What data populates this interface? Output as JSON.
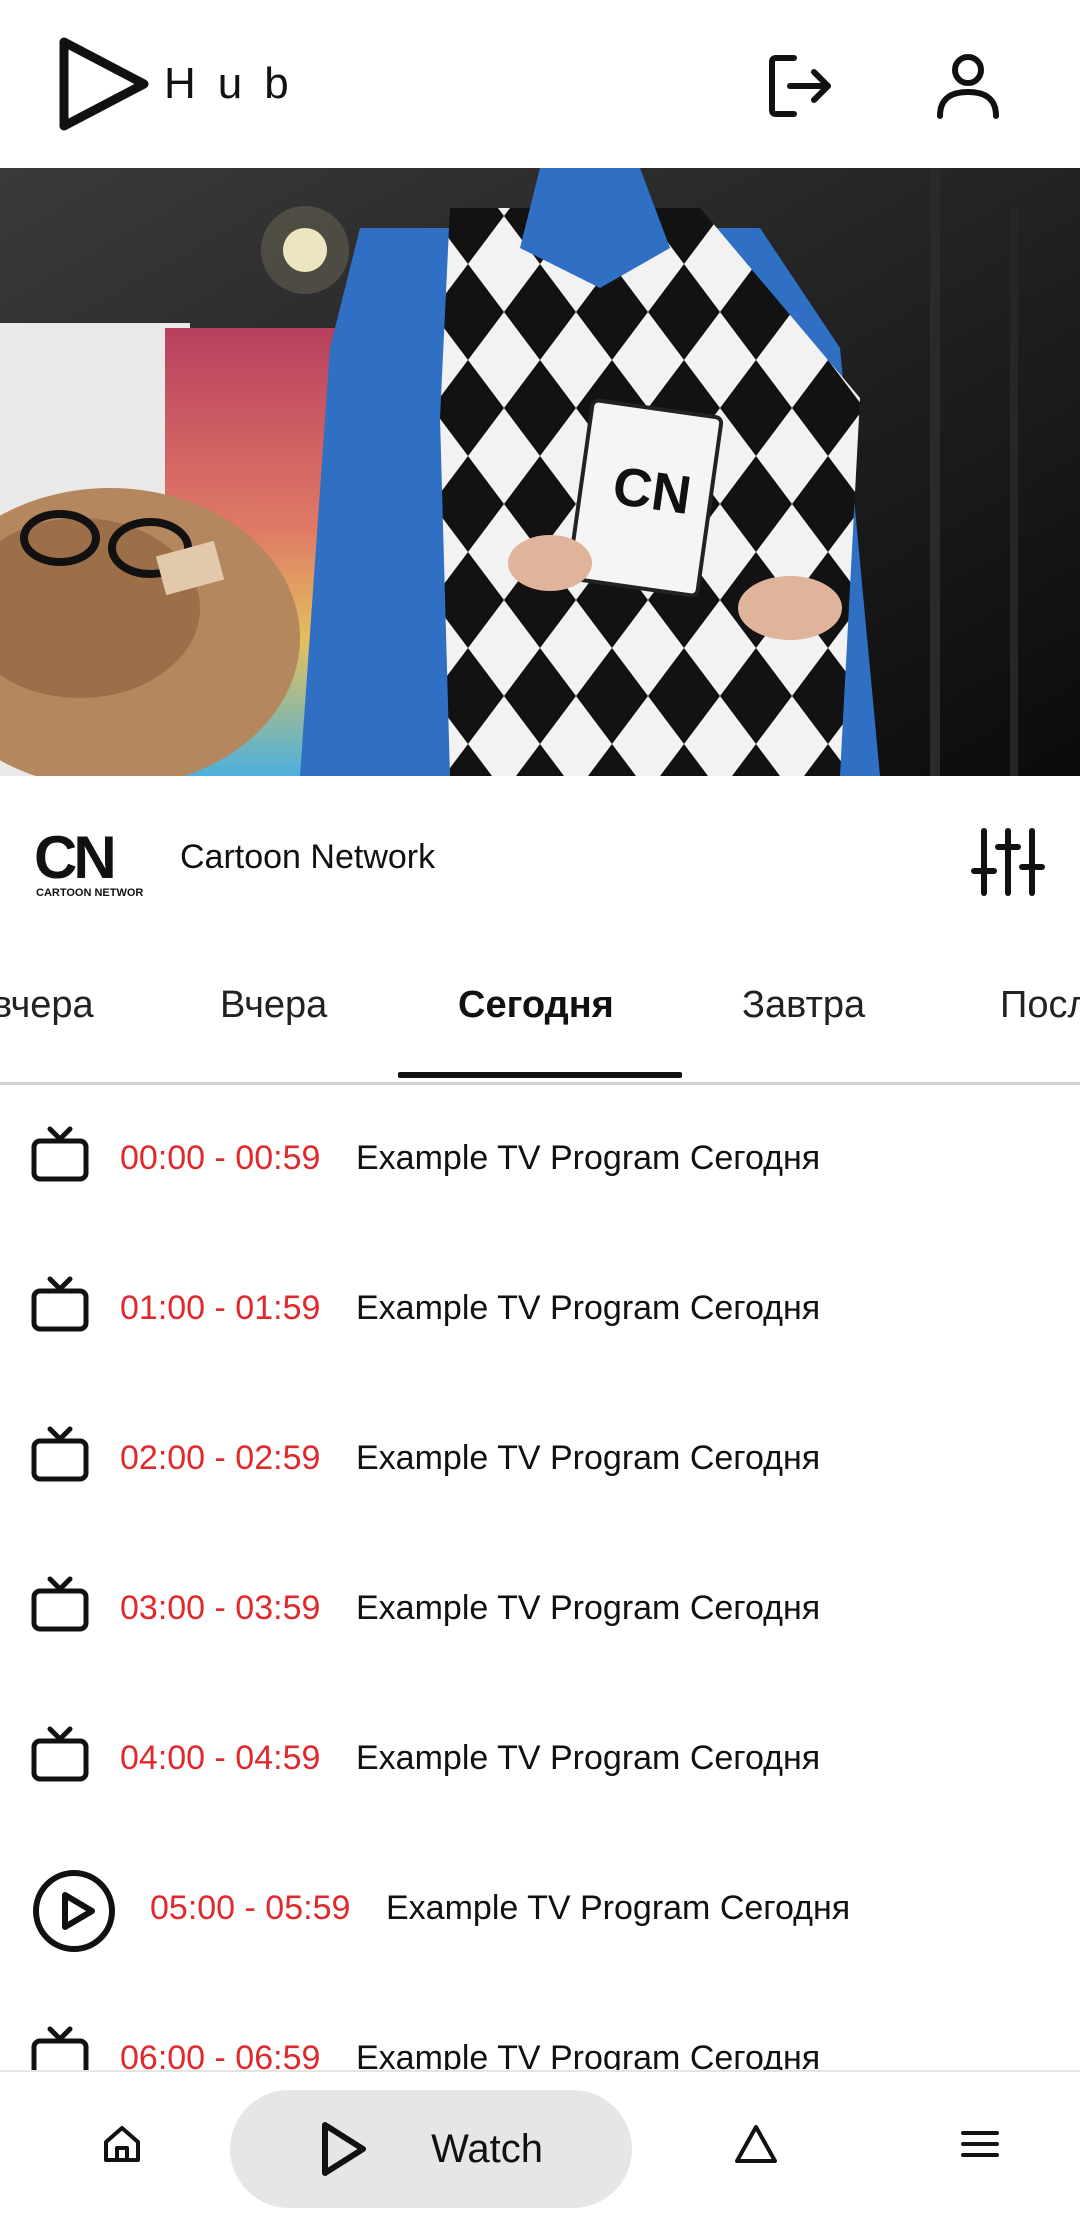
{
  "app": {
    "logo_text": "Hub"
  },
  "header": {
    "logout_icon": "logout-icon",
    "profile_icon": "user-icon"
  },
  "player": {
    "image": "video-frame",
    "logo_text_on_book": "CN"
  },
  "channel": {
    "logo_text": "CN",
    "logo_subtext": "CARTOON NETWORK",
    "name": "Cartoon Network",
    "settings_icon": "sliders-icon"
  },
  "tabs": [
    {
      "label": "Позавчера",
      "visible": "вчера",
      "active": false
    },
    {
      "label": "Вчера",
      "active": false
    },
    {
      "label": "Сегодня",
      "active": true
    },
    {
      "label": "Завтра",
      "active": false
    },
    {
      "label": "Посл",
      "active": false
    }
  ],
  "programs": [
    {
      "time": "00:00 - 00:59",
      "title": "Example TV Program Сегодня",
      "icon": "tv-icon"
    },
    {
      "time": "01:00 - 01:59",
      "title": "Example TV Program Сегодня",
      "icon": "tv-icon"
    },
    {
      "time": "02:00 - 02:59",
      "title": "Example TV Program Сегодня",
      "icon": "tv-icon"
    },
    {
      "time": "03:00 - 03:59",
      "title": "Example TV Program Сегодня",
      "icon": "tv-icon"
    },
    {
      "time": "04:00 - 04:59",
      "title": "Example TV Program Сегодня",
      "icon": "tv-icon"
    },
    {
      "time": "05:00 - 05:59",
      "title": "Example TV Program Сегодня",
      "icon": "play-circle-icon",
      "now_playing": true
    },
    {
      "time": "06:00 - 06:59",
      "title": "Example TV Program Сегодня",
      "icon": "tv-icon"
    }
  ],
  "bottom_nav": {
    "home_icon": "home-icon",
    "watch_label": "Watch",
    "watch_icon": "play-icon",
    "shorts_icon": "triangle-icon",
    "menu_icon": "menu-icon"
  },
  "colors": {
    "time_red": "#e0292d",
    "accent": "#111111",
    "nav_pill": "#e6e6e6"
  }
}
